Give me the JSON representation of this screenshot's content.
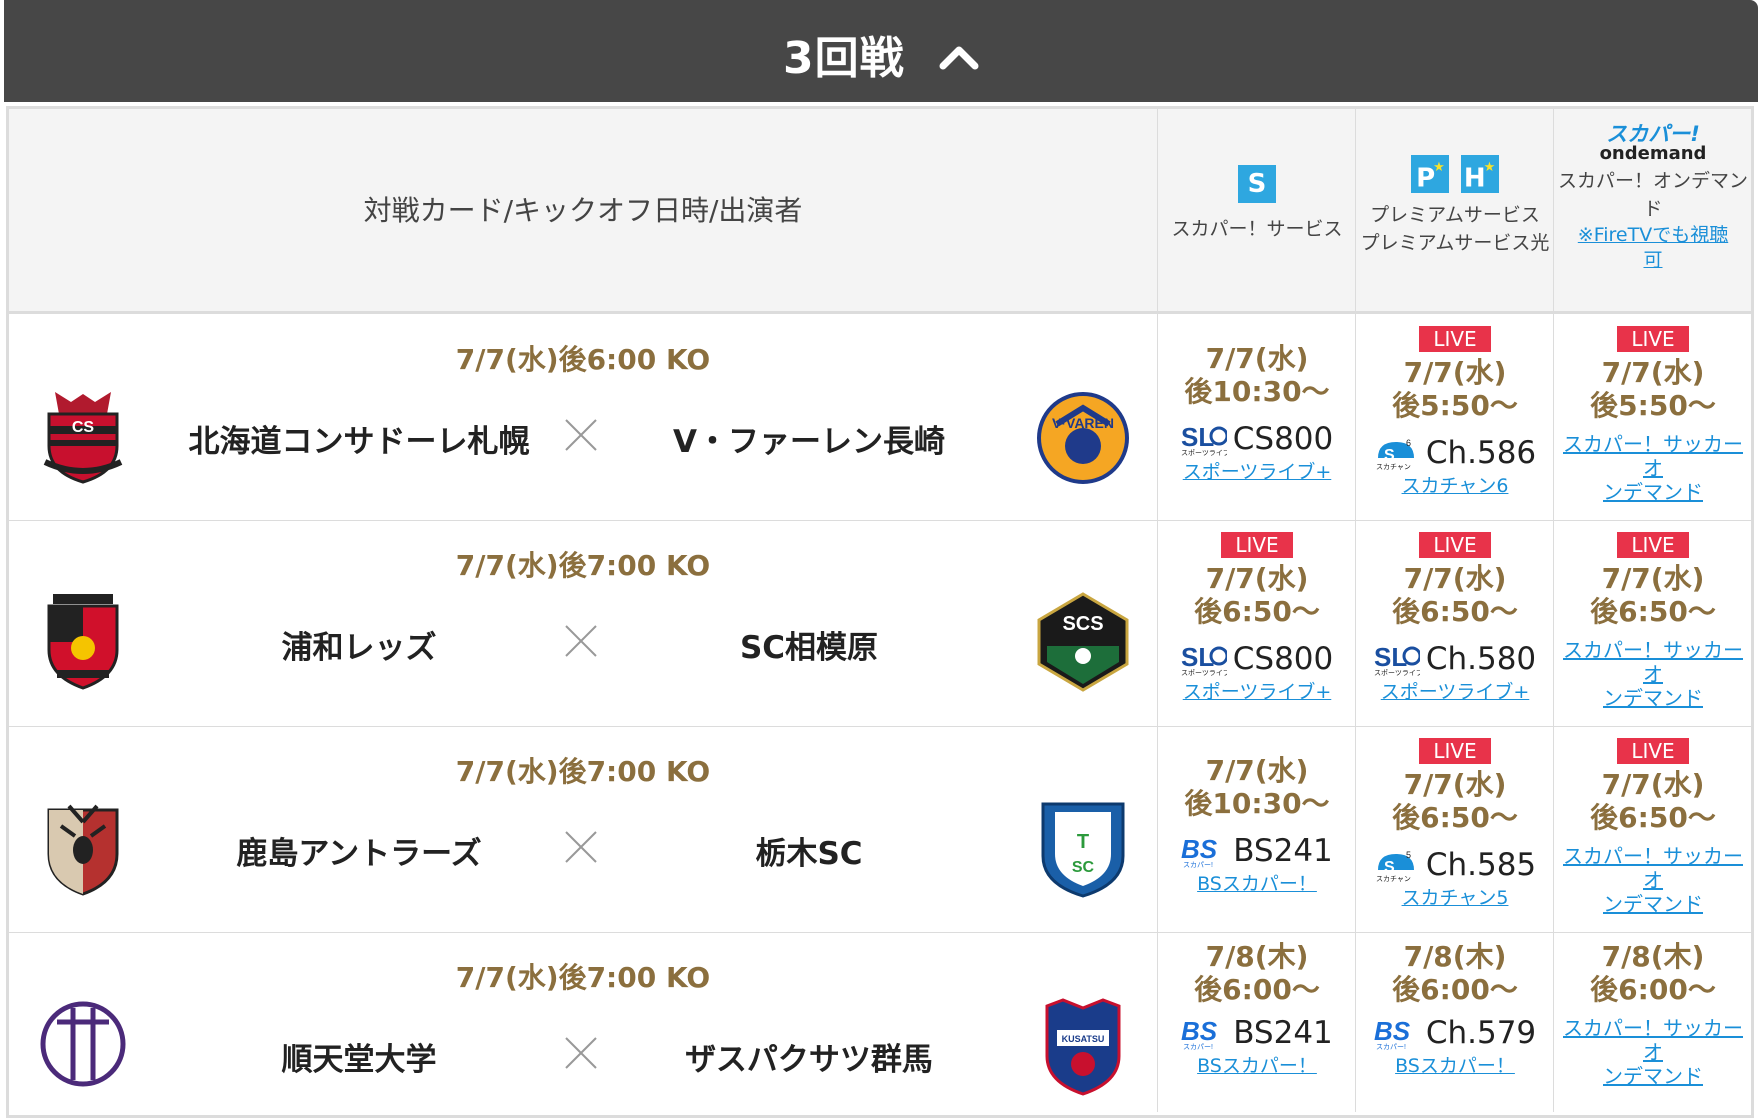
{
  "round": {
    "title": "3回戦"
  },
  "header": {
    "main": "対戦カード/キックオフ日時/出演者",
    "col1": {
      "badge": "S",
      "label": "スカパー！サービス"
    },
    "col2": {
      "badge1": "P",
      "badge2": "H",
      "line1": "プレミアムサービス",
      "line2": "プレミアムサービス光"
    },
    "col3": {
      "logo_top": "スカパー!",
      "logo_bottom": "ondemand",
      "line1": "スカパー！オンデマン",
      "line2": "ド",
      "link1": "※FireTVでも視聴",
      "link2": "可"
    }
  },
  "rows": [
    {
      "ko": "7/7(水)後6:00 KO",
      "home": "北海道コンサドーレ札幌",
      "away": "V・ファーレン長崎",
      "c1": {
        "live": "",
        "date": "7/7(水)",
        "time": "後10:30〜",
        "channel": "CS800",
        "link": "スポーツライブ+"
      },
      "c2": {
        "live": "LIVE",
        "date": "7/7(水)",
        "time": "後5:50〜",
        "channel": "Ch.586",
        "link": "スカチャン6"
      },
      "c3": {
        "live": "LIVE",
        "date": "7/7(水)",
        "time": "後5:50〜",
        "link1": "スカパー！サッカーオ",
        "link2": "ンデマンド"
      }
    },
    {
      "ko": "7/7(水)後7:00 KO",
      "home": "浦和レッズ",
      "away": "SC相模原",
      "c1": {
        "live": "LIVE",
        "date": "7/7(水)",
        "time": "後6:50〜",
        "channel": "CS800",
        "link": "スポーツライブ+"
      },
      "c2": {
        "live": "LIVE",
        "date": "7/7(水)",
        "time": "後6:50〜",
        "channel": "Ch.580",
        "link": "スポーツライブ+"
      },
      "c3": {
        "live": "LIVE",
        "date": "7/7(水)",
        "time": "後6:50〜",
        "link1": "スカパー！サッカーオ",
        "link2": "ンデマンド"
      }
    },
    {
      "ko": "7/7(水)後7:00 KO",
      "home": "鹿島アントラーズ",
      "away": "栃木SC",
      "c1": {
        "live": "",
        "date": "7/7(水)",
        "time": "後10:30〜",
        "channel": "BS241",
        "link": "BSスカパー！"
      },
      "c2": {
        "live": "LIVE",
        "date": "7/7(水)",
        "time": "後6:50〜",
        "channel": "Ch.585",
        "link": "スカチャン5"
      },
      "c3": {
        "live": "LIVE",
        "date": "7/7(水)",
        "time": "後6:50〜",
        "link1": "スカパー！サッカーオ",
        "link2": "ンデマンド"
      }
    },
    {
      "ko": "7/7(水)後7:00 KO",
      "home": "順天堂大学",
      "away": "ザスパクサツ群馬",
      "c1": {
        "live": "",
        "date": "7/8(木)",
        "time": "後6:00〜",
        "channel": "BS241",
        "link": "BSスカパー！"
      },
      "c2": {
        "live": "",
        "date": "7/8(木)",
        "time": "後6:00〜",
        "channel": "Ch.579",
        "link": "BSスカパー！"
      },
      "c3": {
        "live": "",
        "date": "7/8(木)",
        "time": "後6:00〜",
        "link1": "スカパー！サッカーオ",
        "link2": "ンデマンド"
      }
    }
  ],
  "icons": {
    "row0_c1": "sportslive-logo-icon",
    "row0_c2": "skachan-logo-icon",
    "row1_c1": "sportslive-logo-icon",
    "row1_c2": "sportslive-logo-icon",
    "row2_c1": "bs-skyperfect-logo-icon",
    "row2_c2": "skachan-logo-icon",
    "row3_c1": "bs-skyperfect-logo-icon",
    "row3_c2": "bs-skyperfect-logo-icon"
  },
  "colors": {
    "header_bg": "#474747",
    "gold": "#8b6f3e",
    "live_red": "#e8334a",
    "link_blue": "#1a8fd8",
    "badge_blue": "#2ea7e0"
  }
}
